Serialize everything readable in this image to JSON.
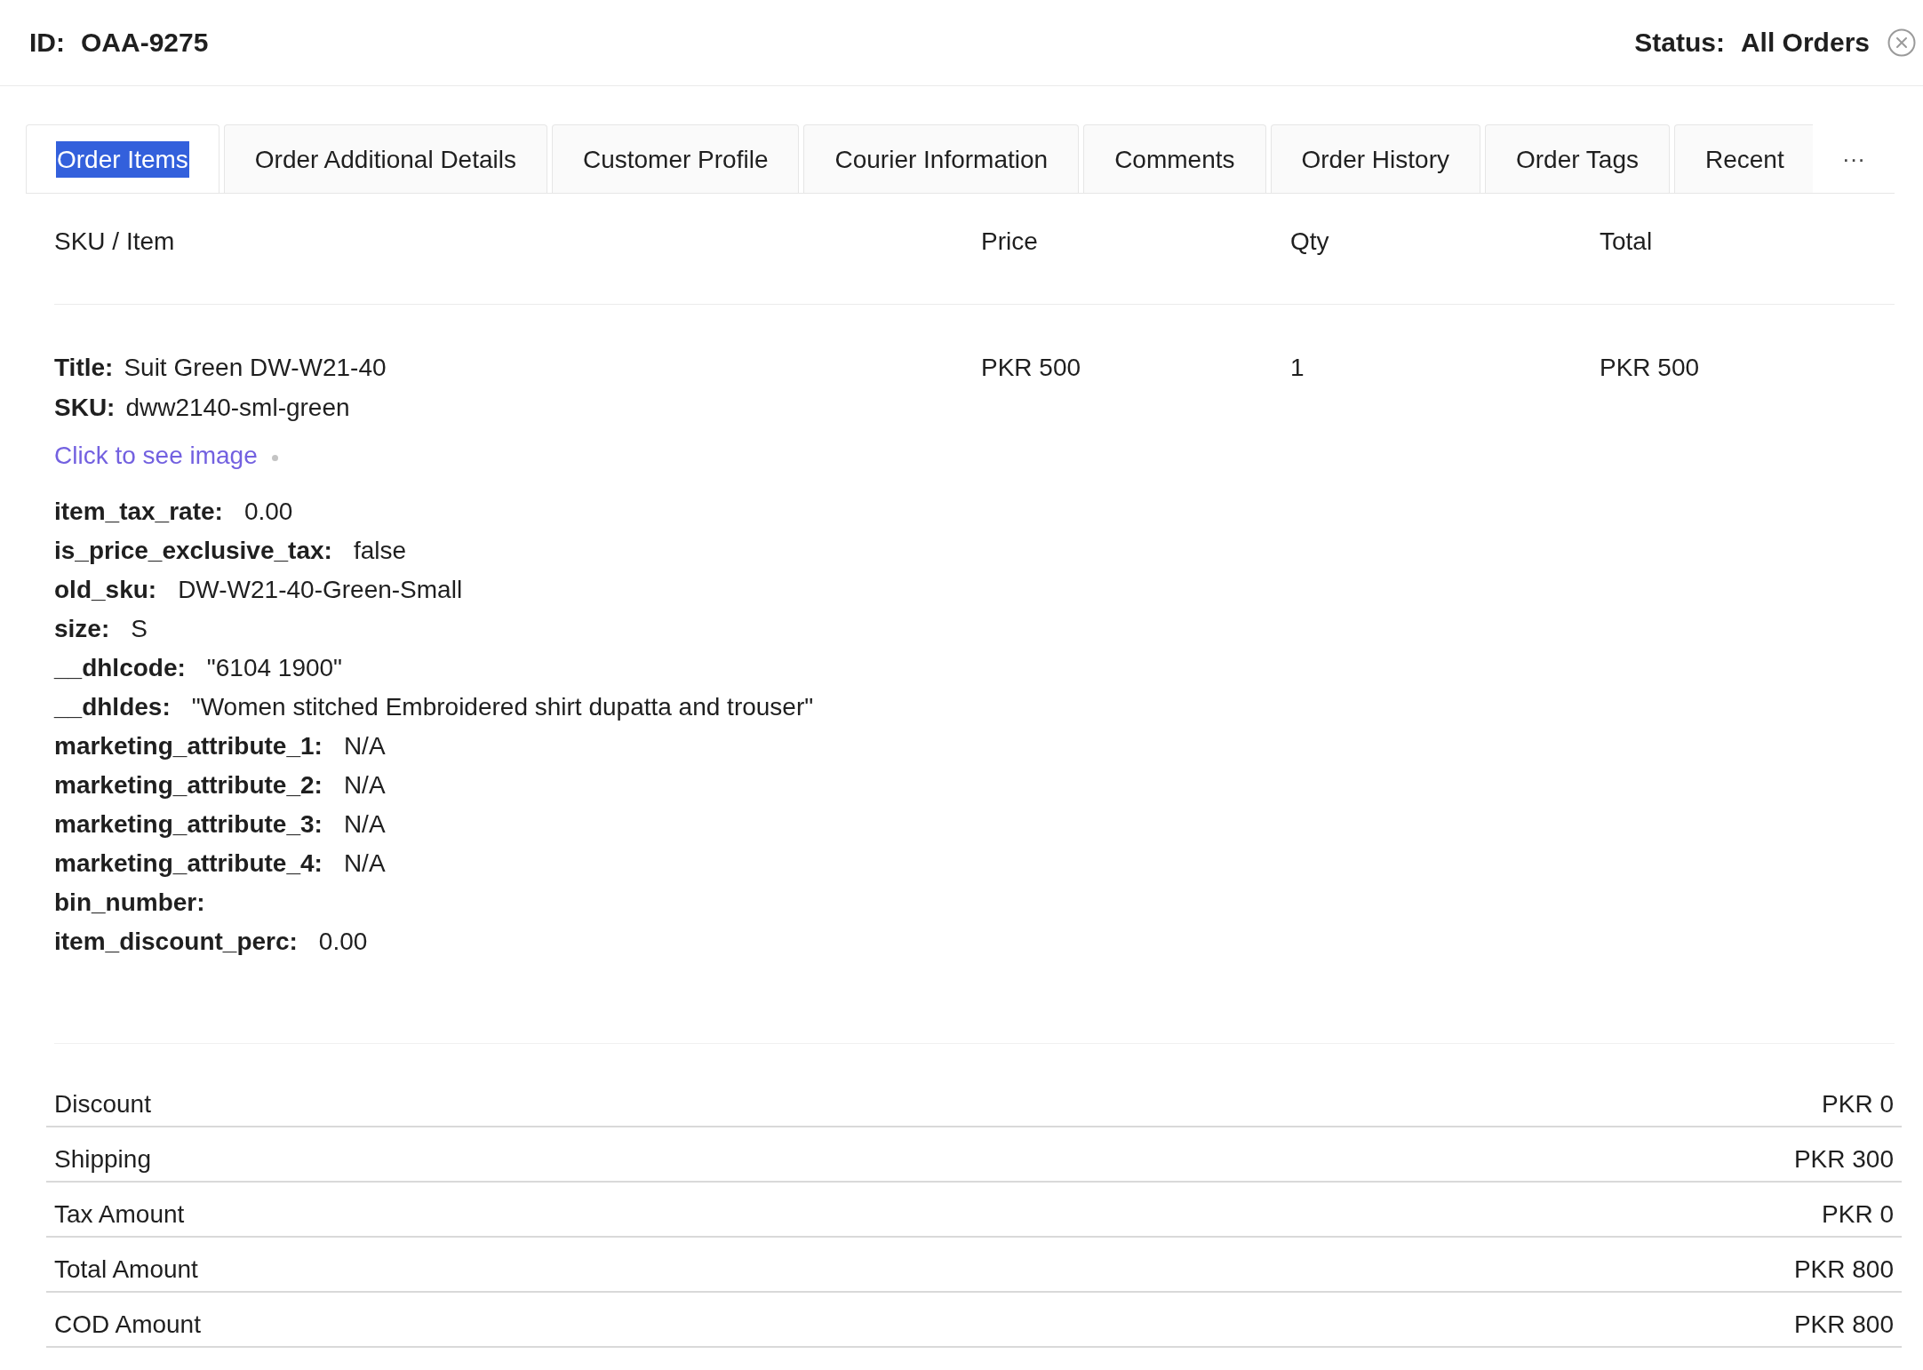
{
  "header": {
    "id_label": "ID:",
    "id_value": "OAA-9275",
    "status_label": "Status:",
    "status_value": "All Orders"
  },
  "tabs": [
    {
      "label": "Order Items",
      "selected": true,
      "highlighted": true
    },
    {
      "label": "Order Additional Details",
      "selected": false,
      "highlighted": false
    },
    {
      "label": "Customer Profile",
      "selected": false,
      "highlighted": false
    },
    {
      "label": "Courier Information",
      "selected": false,
      "highlighted": false
    },
    {
      "label": "Comments",
      "selected": false,
      "highlighted": false
    },
    {
      "label": "Order History",
      "selected": false,
      "highlighted": false
    },
    {
      "label": "Order Tags",
      "selected": false,
      "highlighted": false
    },
    {
      "label": "Recent",
      "selected": false,
      "highlighted": false
    }
  ],
  "tabs_more": "···",
  "table": {
    "columns": [
      "SKU / Item",
      "Price",
      "Qty",
      "Total"
    ],
    "rows": [
      {
        "details": [
          {
            "label": "Title:",
            "value": "Suit Green DW-W21-40"
          },
          {
            "label": "SKU:",
            "value": "dww2140-sml-green"
          }
        ],
        "image_link": "Click to see image",
        "attributes": [
          {
            "label": "item_tax_rate:",
            "value": "0.00"
          },
          {
            "label": "is_price_exclusive_tax:",
            "value": "false"
          },
          {
            "label": "old_sku:",
            "value": "DW-W21-40-Green-Small"
          },
          {
            "label": "size:",
            "value": "S"
          },
          {
            "label": "__dhlcode:",
            "value": "\"6104 1900\""
          },
          {
            "label": "__dhldes:",
            "value": "\"Women stitched Embroidered shirt dupatta and trouser\""
          },
          {
            "label": "marketing_attribute_1:",
            "value": "N/A"
          },
          {
            "label": "marketing_attribute_2:",
            "value": "N/A"
          },
          {
            "label": "marketing_attribute_3:",
            "value": "N/A"
          },
          {
            "label": "marketing_attribute_4:",
            "value": "N/A"
          },
          {
            "label": "bin_number:"
          },
          {
            "label": "item_discount_perc:",
            "value": "0.00"
          }
        ],
        "price": "PKR 500",
        "qty": "1",
        "total": "PKR 500"
      }
    ]
  },
  "summary": [
    {
      "label": "Discount",
      "value": "PKR 0"
    },
    {
      "label": "Shipping",
      "value": "PKR 300"
    },
    {
      "label": "Tax Amount",
      "value": "PKR 0"
    },
    {
      "label": "Total Amount",
      "value": "PKR 800"
    },
    {
      "label": "COD Amount",
      "value": "PKR 800"
    }
  ]
}
